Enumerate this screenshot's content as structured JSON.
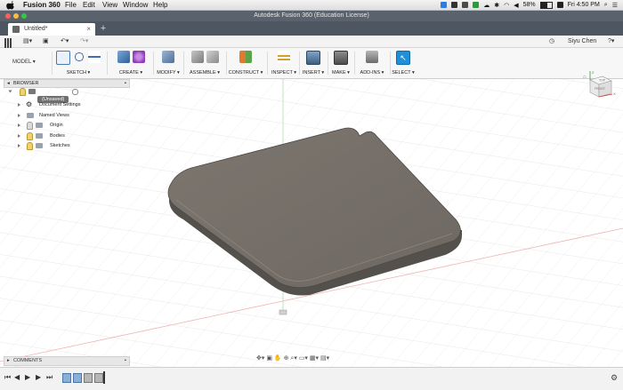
{
  "menubar": {
    "app_name": "Fusion 360",
    "items": [
      "File",
      "Edit",
      "View",
      "Window",
      "Help"
    ],
    "battery": "58%",
    "clock": "Fri 4:50 PM"
  },
  "window": {
    "title": "Autodesk Fusion 360 (Education License)"
  },
  "doc_tab": {
    "label": "Untitled*"
  },
  "qat": {
    "user": "Siyu Chen"
  },
  "ribbon": {
    "workspace": "MODEL",
    "groups": [
      "SKETCH",
      "CREATE",
      "MODIFY",
      "ASSEMBLE",
      "CONSTRUCT",
      "INSPECT",
      "INSERT",
      "MAKE",
      "ADD-INS",
      "SELECT"
    ]
  },
  "browser": {
    "title": "BROWSER",
    "root": "(Unsaved)",
    "items": [
      "Document Settings",
      "Named Views",
      "Origin",
      "Bodies",
      "Sketches"
    ]
  },
  "comments": {
    "title": "COMMENTS"
  },
  "viewcube": {
    "top": "TOP",
    "front": "FRONT",
    "z": "Z",
    "x": "X"
  },
  "colors": {
    "accent": "#0696d7",
    "model": "#76706a",
    "axis_red": "#e36a6a",
    "axis_green": "#7ab87a"
  }
}
